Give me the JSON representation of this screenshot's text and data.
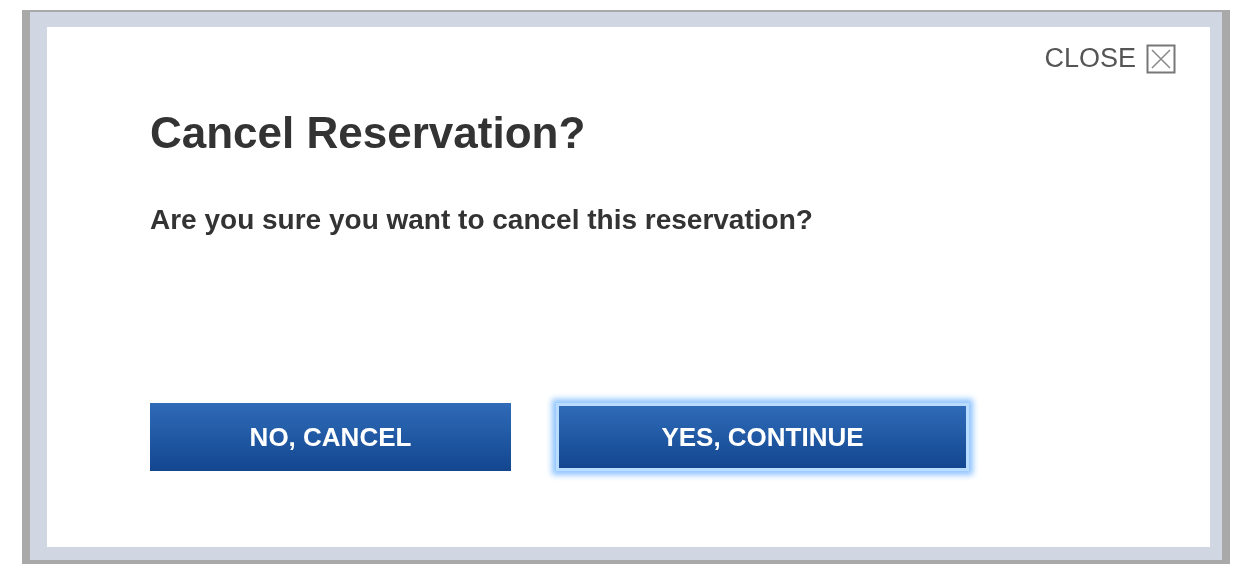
{
  "dialog": {
    "close_label": "CLOSE",
    "title": "Cancel Reservation?",
    "message": "Are you sure you want to cancel this reservation?",
    "buttons": [
      {
        "label": "NO, CANCEL",
        "focused": false
      },
      {
        "label": "YES, CONTINUE",
        "focused": true
      }
    ]
  }
}
